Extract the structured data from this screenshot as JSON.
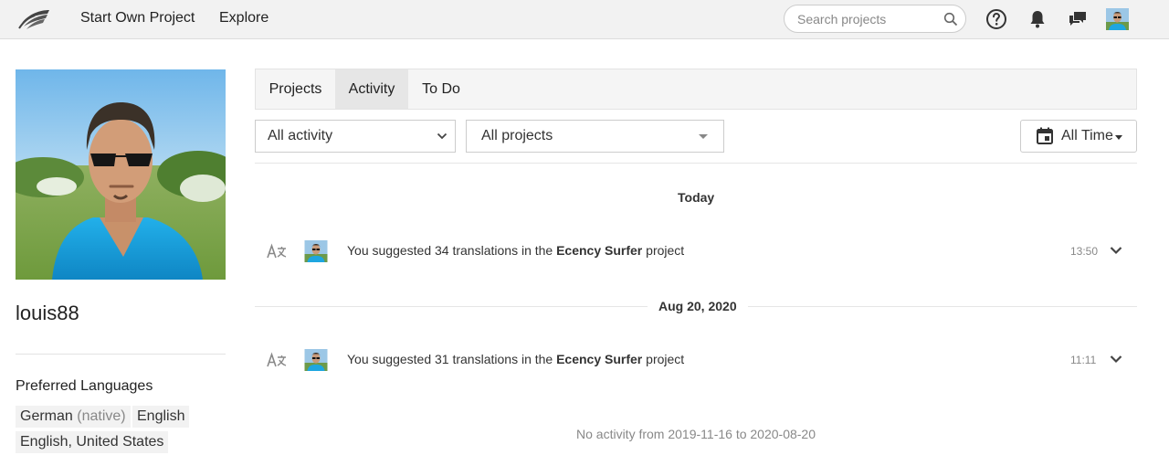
{
  "navbar": {
    "links": [
      "Start Own Project",
      "Explore"
    ],
    "search": {
      "placeholder": "Search projects",
      "value": ""
    },
    "icons": [
      "logo-wings-icon",
      "search-icon",
      "help-icon",
      "bell-icon",
      "chat-icon",
      "user-avatar"
    ]
  },
  "profile": {
    "username": "louis88",
    "preferred_languages_title": "Preferred Languages",
    "languages": [
      {
        "name": "German",
        "note": "(native)"
      },
      {
        "name": "English",
        "note": ""
      },
      {
        "name": "English, United States",
        "note": ""
      }
    ]
  },
  "tabs": [
    {
      "label": "Projects",
      "active": false
    },
    {
      "label": "Activity",
      "active": true
    },
    {
      "label": "To Do",
      "active": false
    }
  ],
  "filters": {
    "activity": "All activity",
    "projects": "All projects",
    "time": "All Time"
  },
  "activity_groups": [
    {
      "day": "Today",
      "items": [
        {
          "prefix": "You suggested 34 translations in the ",
          "project": "Ecency Surfer",
          "suffix": " project",
          "time": "13:50"
        }
      ]
    },
    {
      "day": "Aug 20, 2020",
      "items": [
        {
          "prefix": "You suggested 31 translations in the ",
          "project": "Ecency Surfer",
          "suffix": " project",
          "time": "11:11"
        }
      ]
    }
  ],
  "no_activity_text": "No activity from 2019-11-16 to 2020-08-20",
  "colors": {
    "navbar_bg": "#f2f2f2",
    "active_tab_bg": "#e6e6e6",
    "muted_text": "#888888"
  }
}
